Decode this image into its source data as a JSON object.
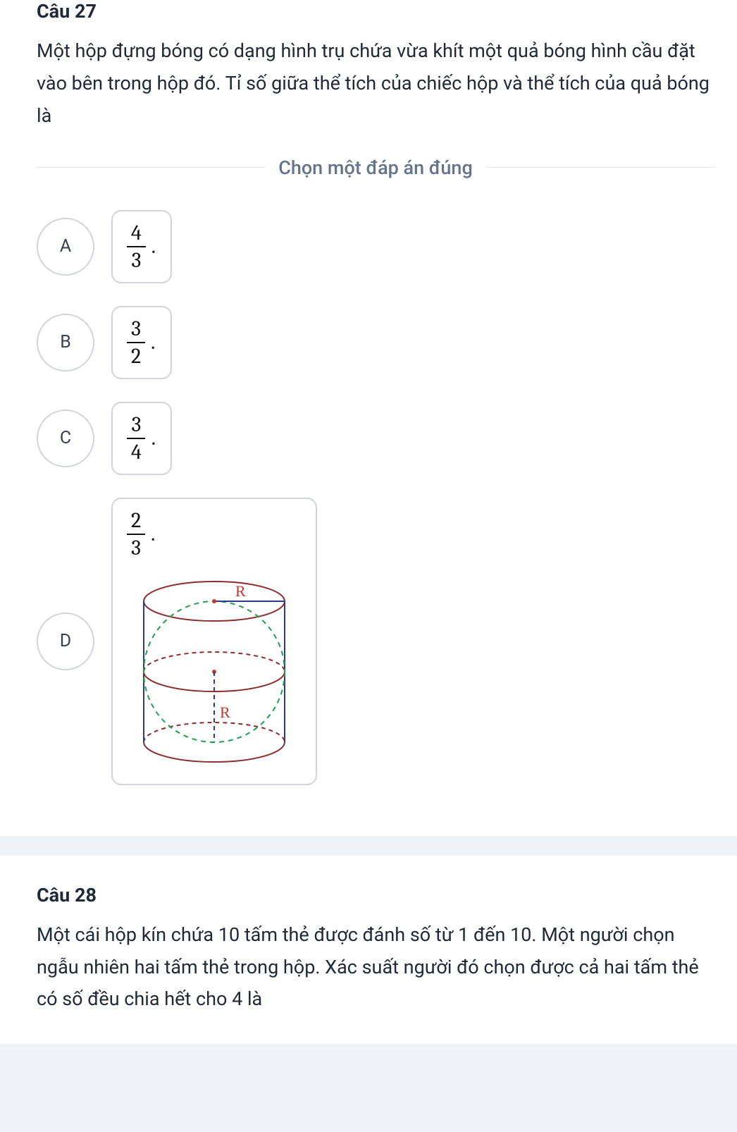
{
  "q27": {
    "title": "Câu 27",
    "body": "Một hộp đựng bóng có dạng hình trụ chứa vừa khít một quả bóng hình cầu đặt vào bên trong hộp đó. Tỉ số giữa thể tích của chiếc hộp và thể tích của quả bóng là",
    "instruction": "Chọn một đáp án đúng",
    "options": {
      "A": {
        "letter": "A",
        "num": "4",
        "den": "3"
      },
      "B": {
        "letter": "B",
        "num": "3",
        "den": "2"
      },
      "C": {
        "letter": "C",
        "num": "3",
        "den": "4"
      },
      "D": {
        "letter": "D",
        "num": "2",
        "den": "3",
        "labelR1": "R",
        "labelR2": "R"
      }
    }
  },
  "q28": {
    "title": "Câu 28",
    "body": "Một cái hộp kín chứa 10 tấm thẻ được đánh số từ 1 đến 10. Một người chọn ngẫu nhiên hai tấm thẻ trong hộp. Xác suất người đó chọn được cả hai tấm thẻ có số đều chia hết cho 4 là"
  }
}
